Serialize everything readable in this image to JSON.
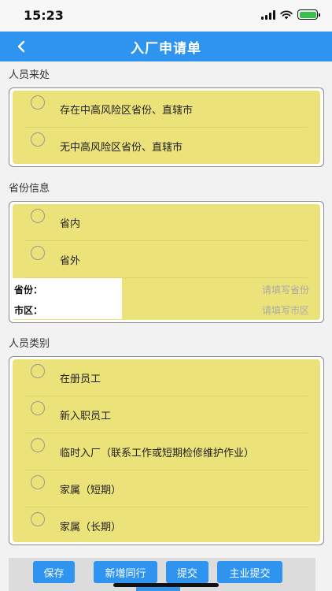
{
  "status": {
    "time": "15:23"
  },
  "header": {
    "title": "入厂申请单"
  },
  "sections": {
    "origin": {
      "label": "人员来处",
      "options": [
        "存在中高风险区省份、直辖市",
        "无中高风险区省份、直辖市"
      ]
    },
    "province": {
      "label": "省份信息",
      "options": [
        "省内",
        "省外"
      ],
      "fields": [
        {
          "label": "省份：",
          "placeholder": "请填写省份"
        },
        {
          "label": "市区：",
          "placeholder": "请填写市区"
        }
      ]
    },
    "category": {
      "label": "人员类别",
      "options": [
        "在册员工",
        "新入职员工",
        "临时入厂（联系工作或短期检修维护作业）",
        "家属（短期）",
        "家属（长期）"
      ]
    }
  },
  "actions": {
    "save": "保存",
    "add_companion": "新增同行",
    "submit": "提交",
    "main_submit": "主业提交"
  },
  "colors": {
    "primary": "#2f93f0",
    "option_bg": "#ebe27a"
  }
}
